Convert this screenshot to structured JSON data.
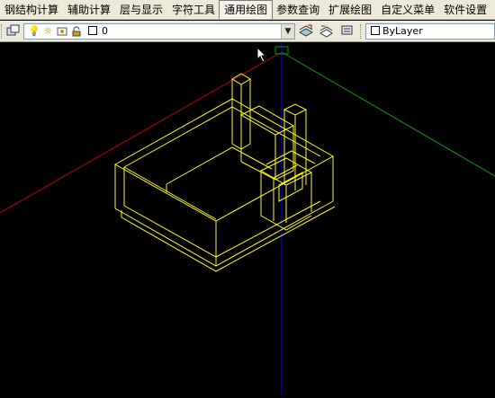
{
  "menubar": {
    "items": [
      "钢结构计算",
      "辅助计算",
      "层与显示",
      "字符工具",
      "通用绘图",
      "参数查询",
      "扩展绘图",
      "自定义菜单",
      "软件设置"
    ],
    "active_index": 4
  },
  "layer_toolbar": {
    "current_layer": "0"
  },
  "properties_toolbar": {
    "color": "ByLayer"
  },
  "colors": {
    "menubar_bg": "#ece9d8",
    "canvas_bg": "#000000",
    "model_lines": "#ffff00",
    "x_axis": "#c00000",
    "y_axis": "#00a000",
    "z_axis": "#0000ff"
  }
}
